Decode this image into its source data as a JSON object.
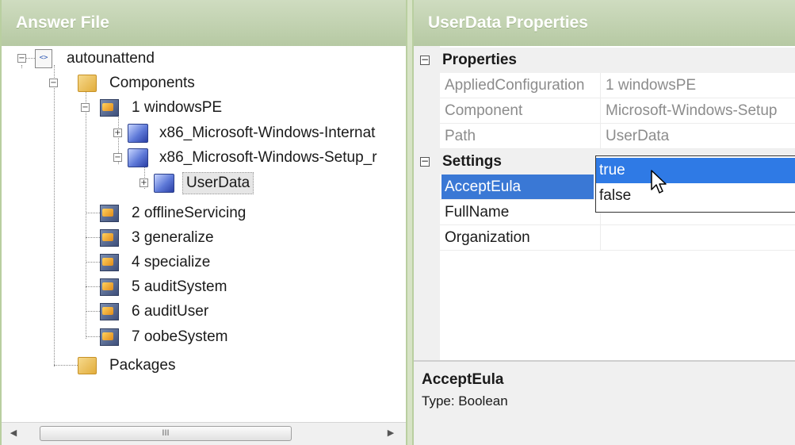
{
  "answer_file": {
    "title": "Answer File",
    "tree": {
      "root": "autounattend",
      "components": "Components",
      "windowspe": "1 windowsPE",
      "intl": "x86_Microsoft-Windows-Internat",
      "setup": "x86_Microsoft-Windows-Setup_r",
      "userdata": "UserData",
      "passes": [
        "2 offlineServicing",
        "3 generalize",
        "4 specialize",
        "5 auditSystem",
        "6 auditUser",
        "7 oobeSystem"
      ],
      "packages": "Packages"
    },
    "scrollbar": {
      "left_arrow": "◀",
      "right_arrow": "▶",
      "grip": "III"
    }
  },
  "properties": {
    "title": "UserData Properties",
    "categories": {
      "properties": "Properties",
      "settings": "Settings"
    },
    "toggle": "−",
    "rows": [
      {
        "name": "AppliedConfiguration",
        "value": "1 windowsPE"
      },
      {
        "name": "Component",
        "value": "Microsoft-Windows-Setup"
      },
      {
        "name": "Path",
        "value": "UserData"
      }
    ],
    "settings": [
      {
        "name": "AcceptEula",
        "value": "true"
      },
      {
        "name": "FullName",
        "value": ""
      },
      {
        "name": "Organization",
        "value": ""
      }
    ],
    "dropdown": {
      "button": "▼",
      "options": [
        "true",
        "false"
      ],
      "selected": "true"
    },
    "description": {
      "title": "AcceptEula",
      "text": "Type: Boolean"
    }
  },
  "colors": {
    "header_bg": "#b6c9a3",
    "selection": "#3a78d5",
    "dropdown_highlight": "#2f7ae5"
  }
}
